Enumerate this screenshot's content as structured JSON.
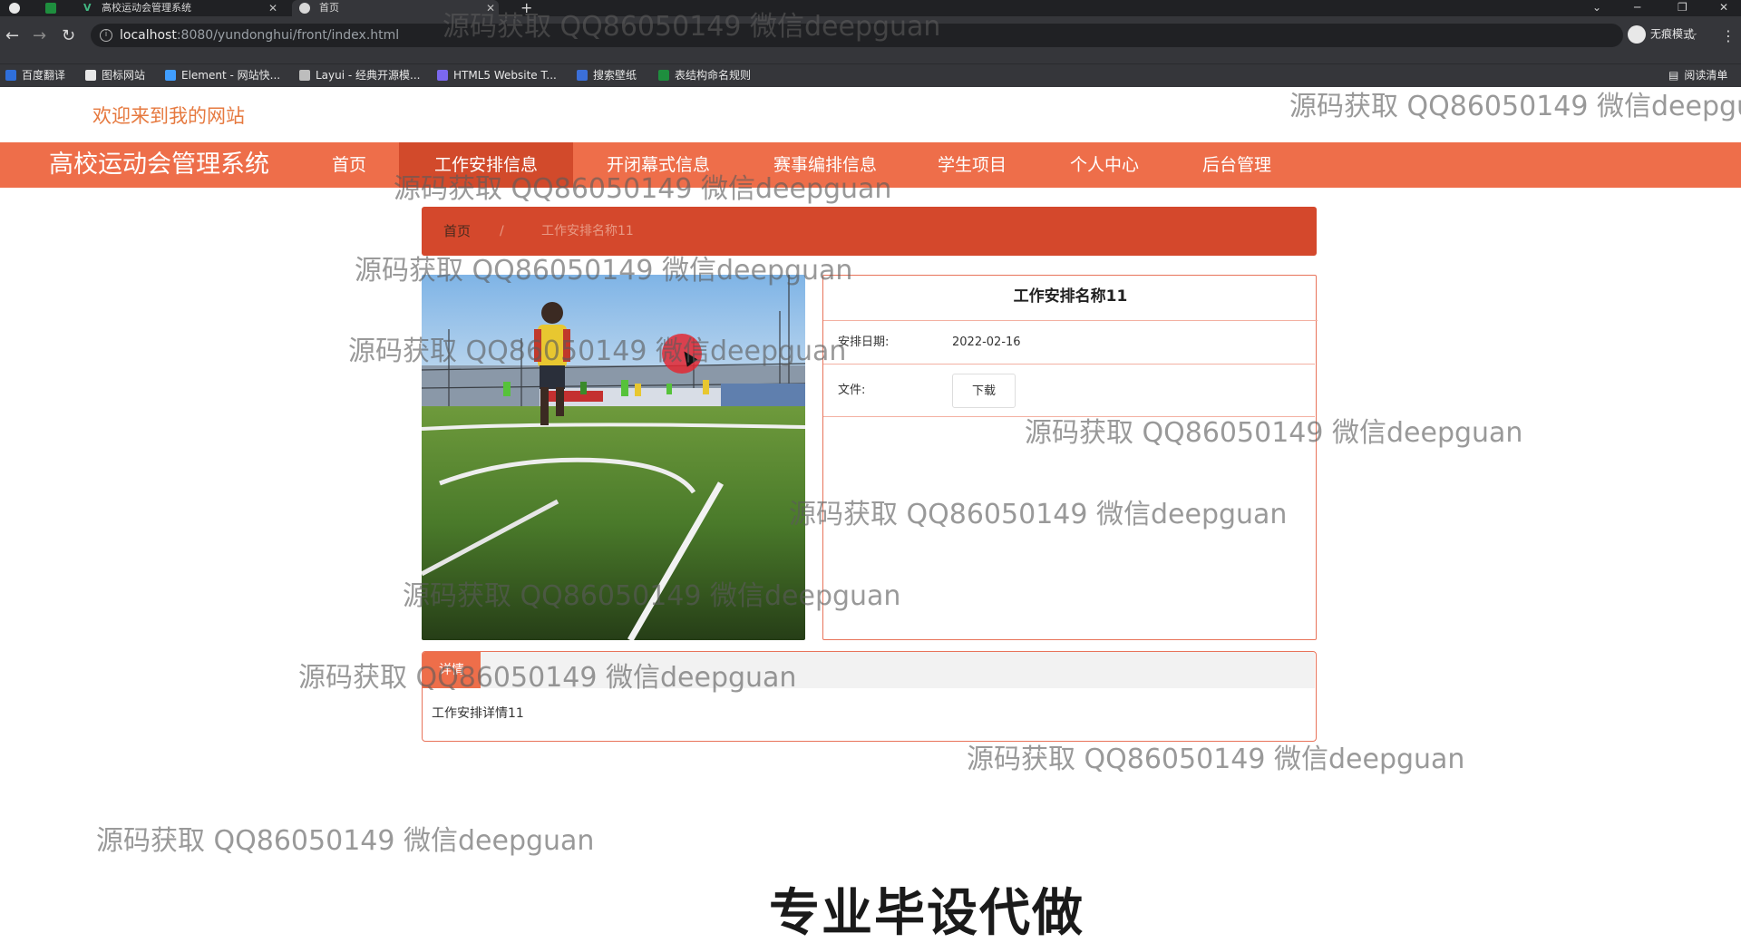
{
  "browser": {
    "tabs": [
      {
        "label": "高校运动会管理系统",
        "active": false
      },
      {
        "label": "首页",
        "active": true
      }
    ],
    "new_tab": "+",
    "url": {
      "host": "localhost",
      "path": ":8080/yundonghui/front/index.html"
    },
    "profile_label": "无痕模式",
    "bookmarks": [
      {
        "label": "百度翻译",
        "icon": "translate-icon"
      },
      {
        "label": "图标网站",
        "icon": "flag-icon"
      },
      {
        "label": "Element - 网站快...",
        "icon": "element-icon"
      },
      {
        "label": "Layui - 经典开源模...",
        "icon": "layui-icon"
      },
      {
        "label": "HTML5 Website T...",
        "icon": "html5-icon"
      },
      {
        "label": "搜索壁纸",
        "icon": "wallpaper-icon"
      },
      {
        "label": "表结构命名规则",
        "icon": "table-icon"
      }
    ],
    "reading_list": "阅读清单"
  },
  "header": {
    "welcome": "欢迎来到我的网站"
  },
  "nav": {
    "brand": "高校运动会管理系统",
    "items": [
      {
        "label": "首页",
        "active": false
      },
      {
        "label": "工作安排信息",
        "active": true
      },
      {
        "label": "开闭幕式信息",
        "active": false
      },
      {
        "label": "赛事编排信息",
        "active": false
      },
      {
        "label": "学生项目",
        "active": false
      },
      {
        "label": "个人中心",
        "active": false
      },
      {
        "label": "后台管理",
        "active": false
      }
    ]
  },
  "breadcrumb": {
    "home": "首页",
    "separator": "/",
    "current": "工作安排名称11"
  },
  "info": {
    "title": "工作安排名称11",
    "date_label": "安排日期:",
    "date_value": "2022-02-16",
    "file_label": "文件:",
    "download_label": "下载"
  },
  "detail": {
    "tab_label": "详情",
    "content": "工作安排详情11"
  },
  "overlay": {
    "watermark": "源码获取 QQ86050149 微信deepguan",
    "watermark_cut": "源码获取 QQ86050149 微信deepgu",
    "ad": "专业毕设代做"
  },
  "colors": {
    "nav_bg": "#ee6e4a",
    "nav_active": "#d24a2b",
    "breadcrumb_bg": "#d4482c",
    "welcome_text": "#e6793f"
  }
}
